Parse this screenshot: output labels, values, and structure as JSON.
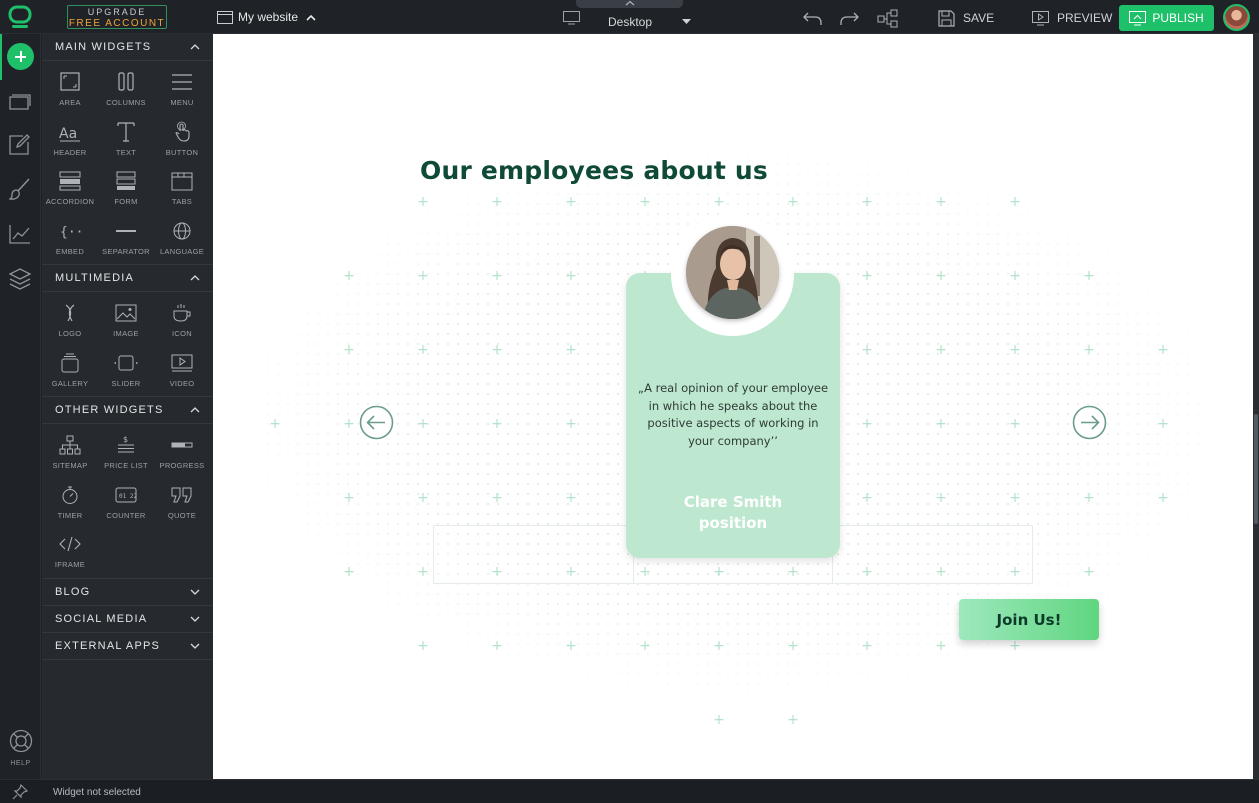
{
  "topbar": {
    "upgrade_line1": "UPGRADE",
    "upgrade_line2": "FREE ACCOUNT",
    "site_name": "My website",
    "device_label": "Desktop",
    "save_label": "SAVE",
    "preview_label": "PREVIEW",
    "publish_label": "PUBLISH"
  },
  "sidebar": {
    "help_label": "HELP",
    "sections": {
      "main": {
        "title": "MAIN WIDGETS",
        "items": [
          "AREA",
          "COLUMNS",
          "MENU",
          "HEADER",
          "TEXT",
          "BUTTON",
          "ACCORDION",
          "FORM",
          "TABS",
          "EMBED",
          "SEPARATOR",
          "LANGUAGE"
        ]
      },
      "multimedia": {
        "title": "MULTIMEDIA",
        "items": [
          "LOGO",
          "IMAGE",
          "ICON",
          "GALLERY",
          "SLIDER",
          "VIDEO"
        ]
      },
      "other": {
        "title": "OTHER WIDGETS",
        "items": [
          "SITEMAP",
          "PRICE LIST",
          "PROGRESS",
          "TIMER",
          "COUNTER",
          "QUOTE",
          "IFRAME"
        ]
      },
      "collapsed": [
        "BLOG",
        "SOCIAL MEDIA",
        "EXTERNAL APPS"
      ]
    }
  },
  "canvas": {
    "heading": "Our employees about us",
    "testimonial": {
      "quote": "„A real opinion of your employee in which he speaks about the positive aspects of working in your company’’",
      "name": "Clare Smith",
      "position": "position"
    },
    "join_button": "Join Us!"
  },
  "status": {
    "message": "Widget not selected"
  },
  "colors": {
    "accent": "#1fc06a",
    "upgrade_orange": "#f0a53a",
    "heading": "#0e4a37",
    "card": "#bde8cf"
  }
}
